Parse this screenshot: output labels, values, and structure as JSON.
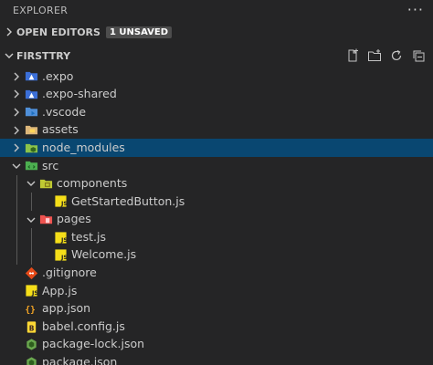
{
  "panel": {
    "title": "EXPLORER",
    "more_actions": "···"
  },
  "open_editors": {
    "label": "OPEN EDITORS",
    "badge": "1 UNSAVED"
  },
  "folder": {
    "name": "FIRSTTRY"
  },
  "tree": [
    {
      "label": ".expo",
      "depth": 1,
      "kind": "folder",
      "expanded": false,
      "icon": "expo-folder-icon"
    },
    {
      "label": ".expo-shared",
      "depth": 1,
      "kind": "folder",
      "expanded": false,
      "icon": "expo-folder-icon"
    },
    {
      "label": ".vscode",
      "depth": 1,
      "kind": "folder",
      "expanded": false,
      "icon": "vscode-folder-icon"
    },
    {
      "label": "assets",
      "depth": 1,
      "kind": "folder",
      "expanded": false,
      "icon": "assets-folder-icon"
    },
    {
      "label": "node_modules",
      "depth": 1,
      "kind": "folder",
      "expanded": false,
      "selected": true,
      "icon": "node-modules-folder-icon"
    },
    {
      "label": "src",
      "depth": 1,
      "kind": "folder",
      "expanded": true,
      "icon": "src-folder-icon"
    },
    {
      "label": "components",
      "depth": 2,
      "kind": "folder",
      "expanded": true,
      "icon": "components-folder-icon"
    },
    {
      "label": "GetStartedButton.js",
      "depth": 3,
      "kind": "file",
      "icon": "js-file-icon"
    },
    {
      "label": "pages",
      "depth": 2,
      "kind": "folder",
      "expanded": true,
      "icon": "pages-folder-icon"
    },
    {
      "label": "test.js",
      "depth": 3,
      "kind": "file",
      "icon": "js-file-icon"
    },
    {
      "label": "Welcome.js",
      "depth": 3,
      "kind": "file",
      "icon": "js-file-icon"
    },
    {
      "label": ".gitignore",
      "depth": 1,
      "kind": "file",
      "icon": "git-file-icon"
    },
    {
      "label": "App.js",
      "depth": 1,
      "kind": "file",
      "icon": "js-file-icon"
    },
    {
      "label": "app.json",
      "depth": 1,
      "kind": "file",
      "icon": "json-file-icon"
    },
    {
      "label": "babel.config.js",
      "depth": 1,
      "kind": "file",
      "icon": "babel-file-icon"
    },
    {
      "label": "package-lock.json",
      "depth": 1,
      "kind": "file",
      "icon": "npm-file-icon"
    },
    {
      "label": "package.json",
      "depth": 1,
      "kind": "file",
      "icon": "npm-file-icon"
    }
  ],
  "colors": {
    "background": "#252526",
    "selection": "#094771",
    "js": "#f5de19",
    "folder": "#dcb67a",
    "expo": "#4d7cfe",
    "node": "#8bc34a",
    "git": "#e64a19"
  }
}
